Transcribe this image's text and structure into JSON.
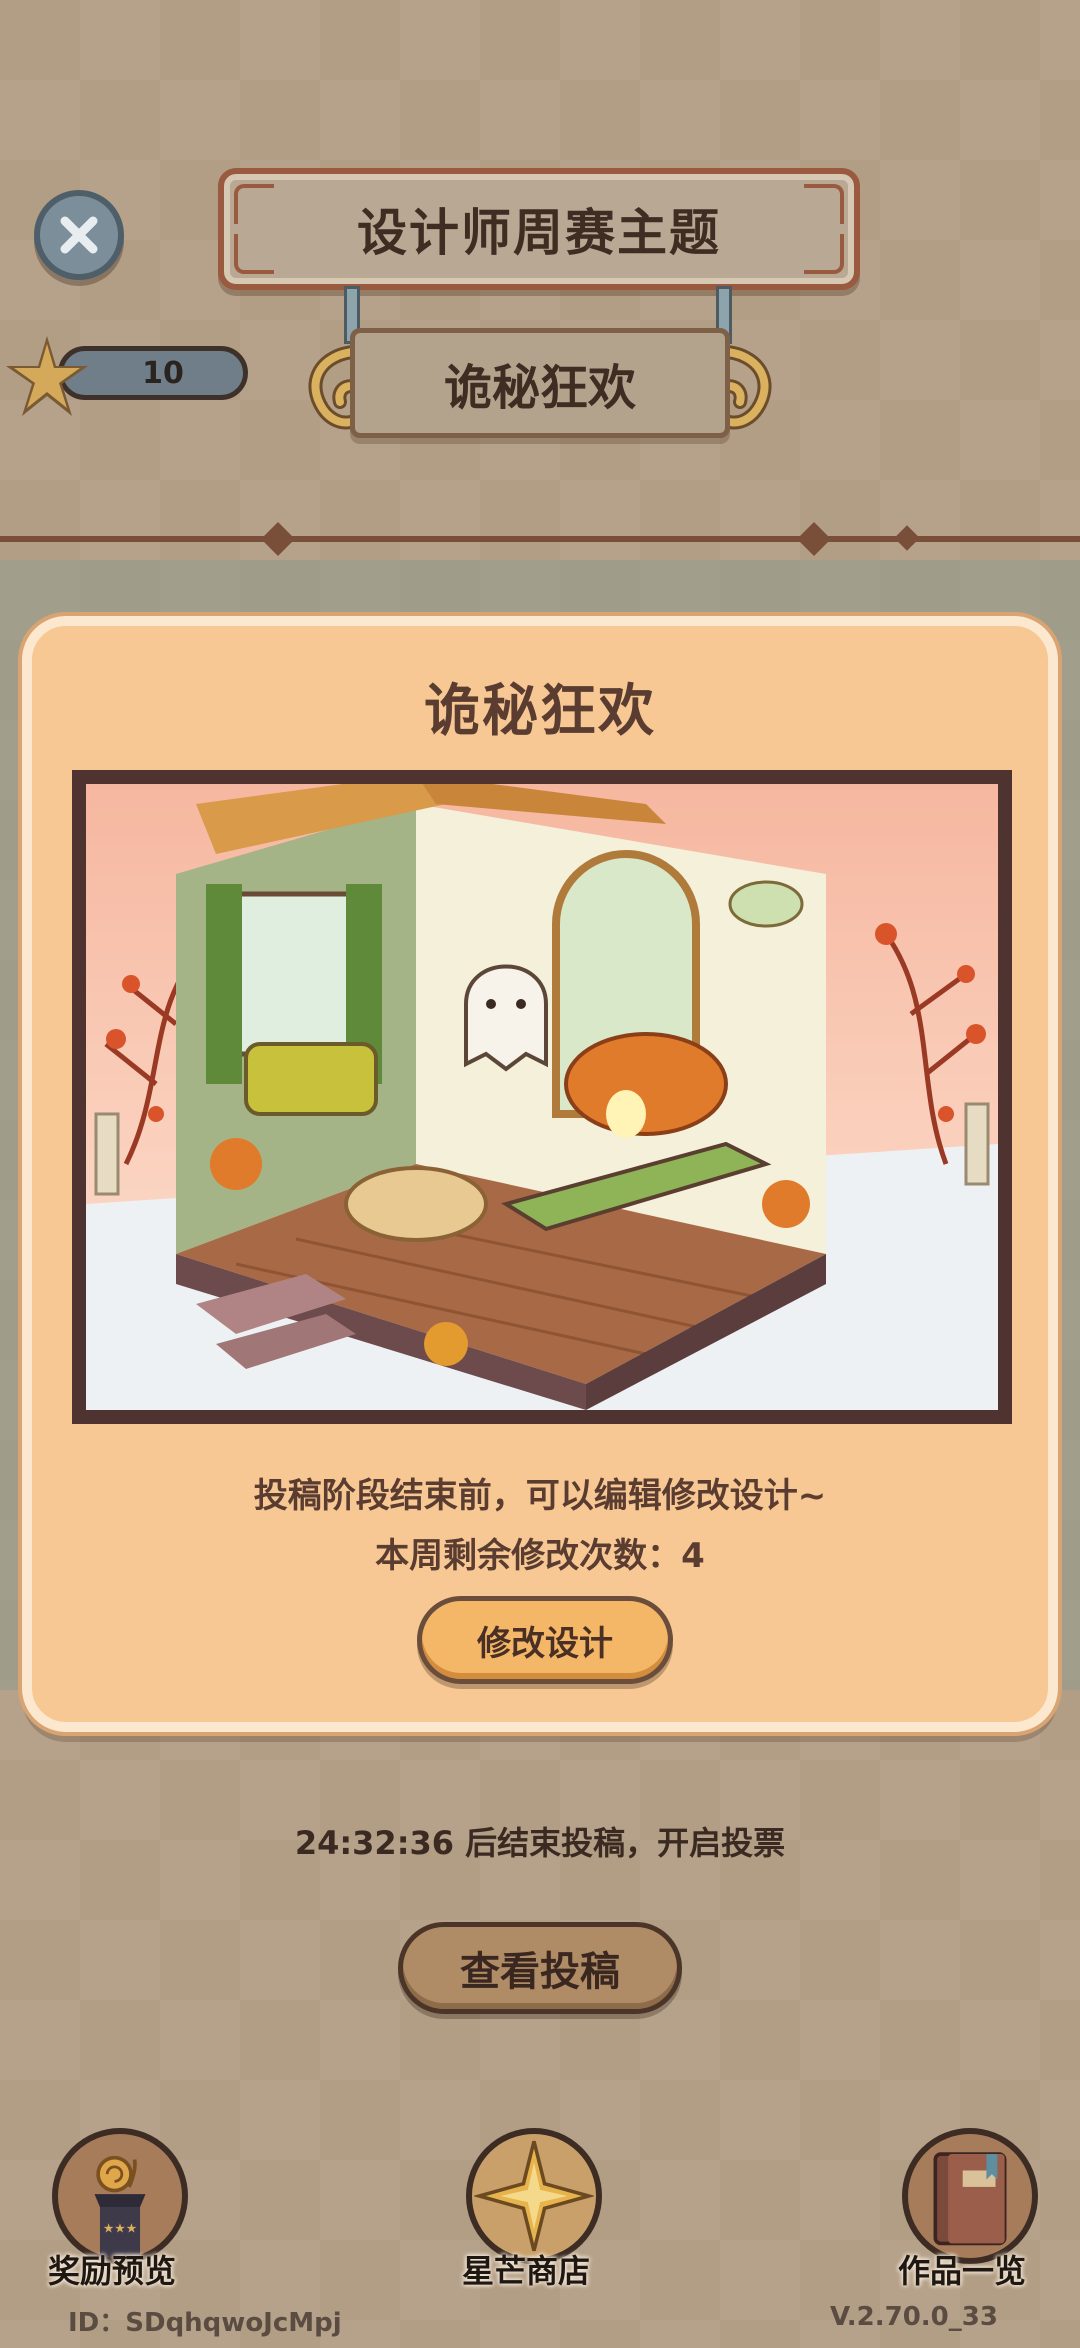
{
  "header": {
    "title": "设计师周赛主题",
    "theme_name": "诡秘狂欢",
    "star_count": "10"
  },
  "modal": {
    "title": "诡秘狂欢",
    "info_line1": "投稿阶段结束前，可以编辑修改设计~",
    "info_line2": "本周剩余修改次数：4",
    "edit_button": "修改设计"
  },
  "status": {
    "countdown": "24:32:36 后结束投稿，开启投票",
    "view_button": "查看投稿"
  },
  "nav": [
    {
      "label": "奖励预览",
      "icon": "trophy-snail-icon"
    },
    {
      "label": "星芒商店",
      "icon": "star-shop-icon"
    },
    {
      "label": "作品一览",
      "icon": "book-icon"
    }
  ],
  "footer": {
    "user_id": "ID：SDqhqwoJcMpj",
    "version": "V.2.70.0_33"
  },
  "colors": {
    "modal_bg": "#f7c893",
    "button_orange": "#f4b768",
    "text_brown": "#5a3c31"
  }
}
